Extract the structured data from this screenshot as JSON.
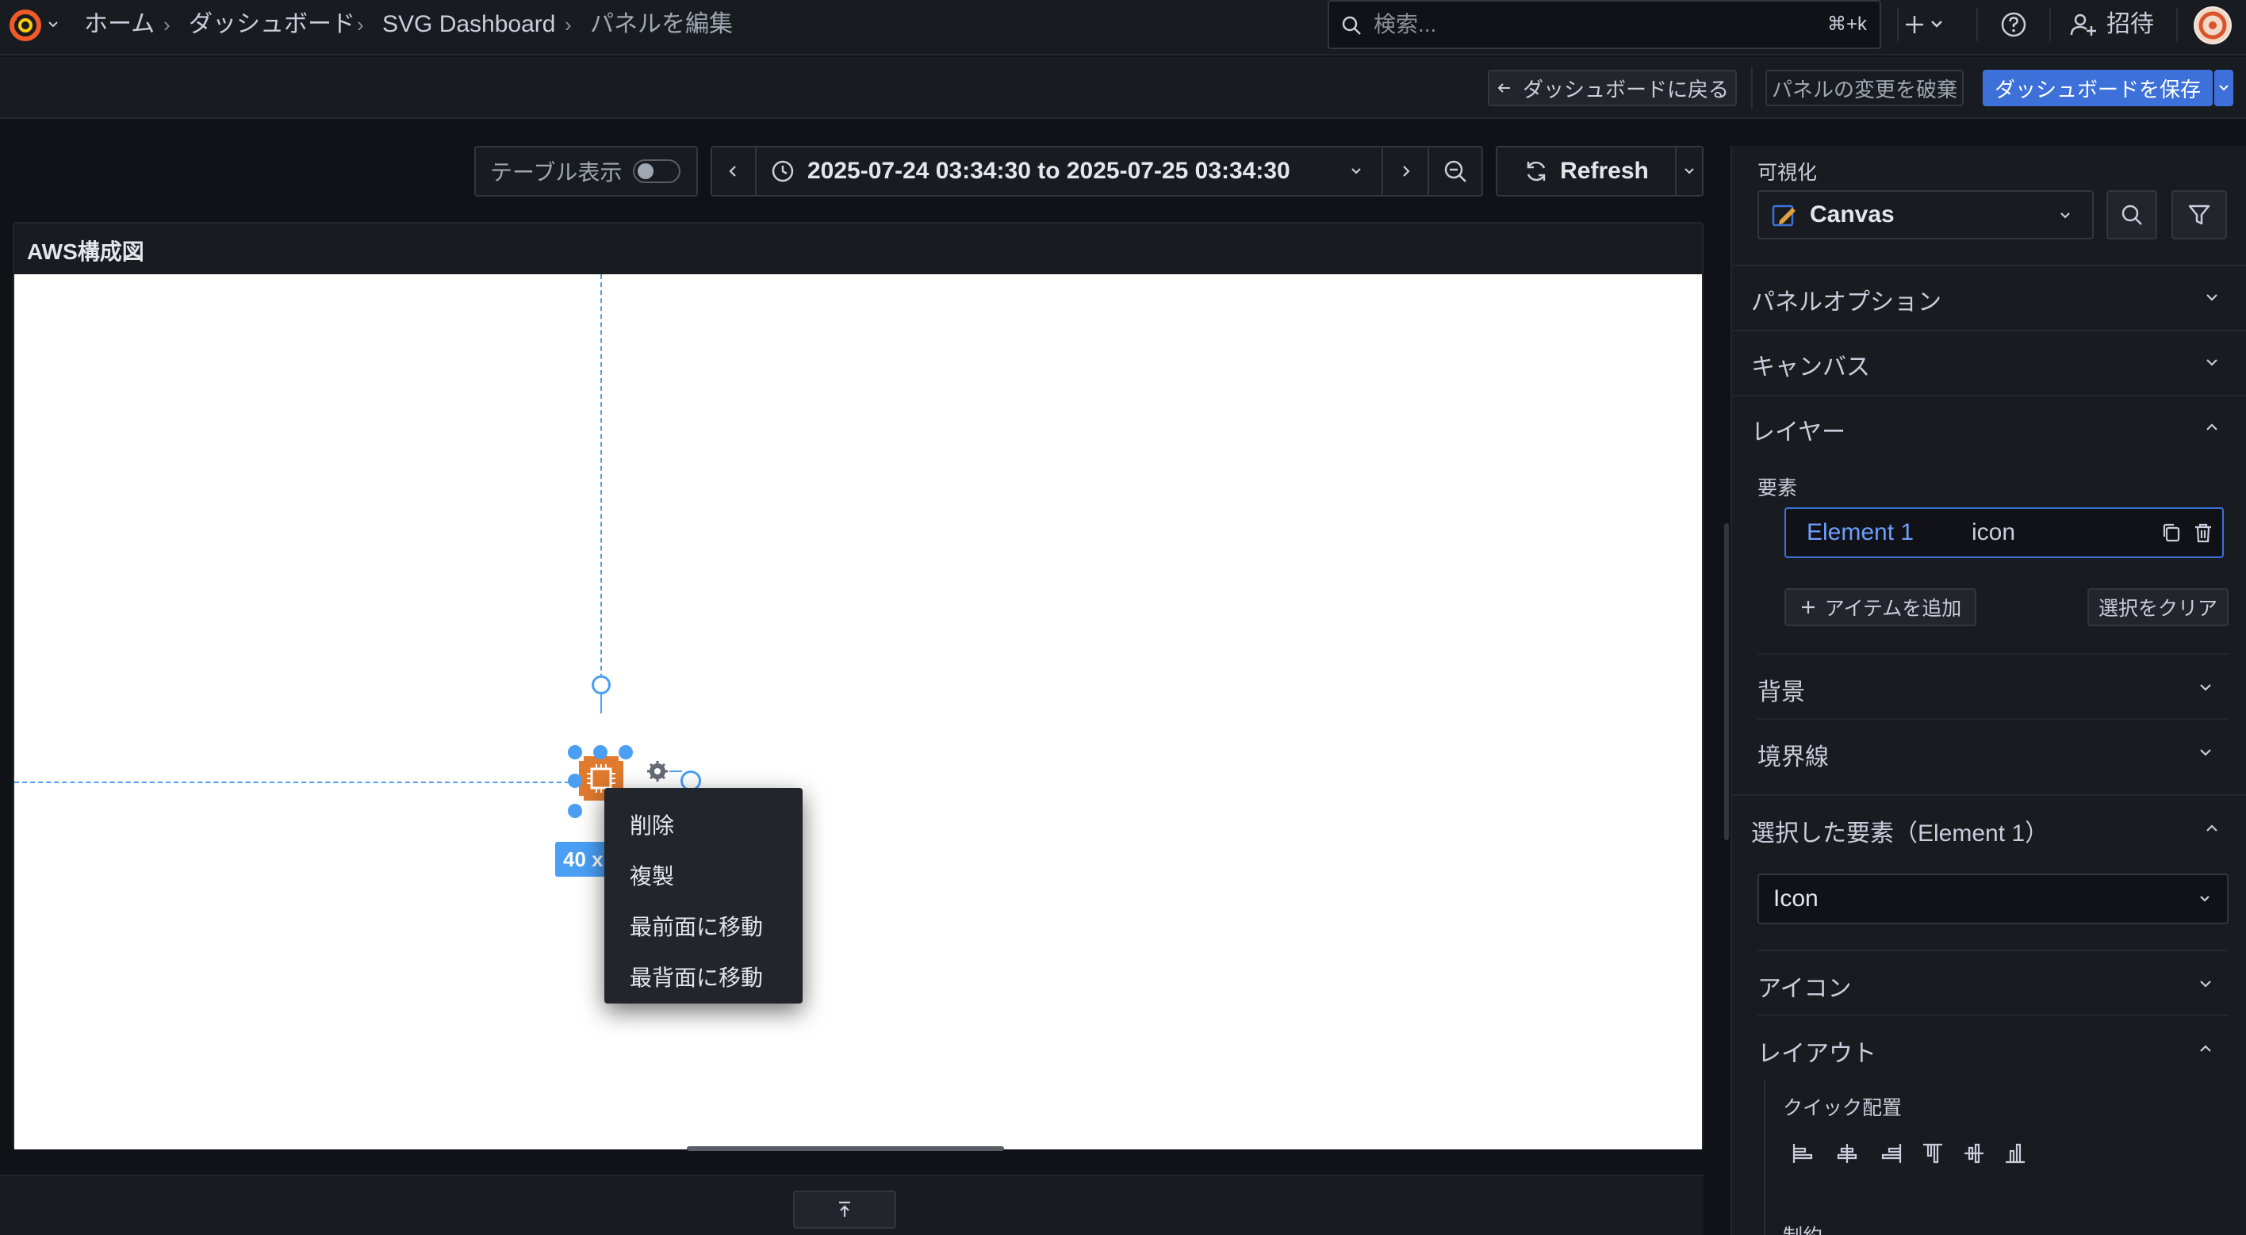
{
  "breadcrumb": {
    "items": [
      "ホーム",
      "ダッシュボード",
      "SVG Dashboard"
    ],
    "current": "パネルを編集"
  },
  "search": {
    "placeholder": "検索...",
    "shortcut": "⌘+k"
  },
  "topbar": {
    "invite_label": "招待"
  },
  "editbar": {
    "back_label": "ダッシュボードに戻る",
    "discard_label": "パネルの変更を破棄",
    "save_label": "ダッシュボードを保存"
  },
  "controls": {
    "table_view_label": "テーブル表示",
    "table_view_on": false,
    "time_range": "2025-07-24 03:34:30 to 2025-07-25 03:34:30",
    "refresh_label": "Refresh"
  },
  "panel": {
    "title": "AWS構成図"
  },
  "element": {
    "size_label": "40 x"
  },
  "context_menu": {
    "items": [
      "削除",
      "複製",
      "最前面に移動",
      "最背面に移動"
    ]
  },
  "right_pane": {
    "visualization_label": "可視化",
    "visualization_value": "Canvas",
    "sections": {
      "panel_options": "パネルオプション",
      "canvas": "キャンバス",
      "layer": "レイヤー",
      "background": "背景",
      "border": "境界線",
      "selected_element": "選択した要素（Element 1）",
      "icon": "アイコン",
      "layout": "レイアウト"
    },
    "elements_label": "要素",
    "element_row": {
      "name": "Element 1",
      "type": "icon"
    },
    "add_item_label": "アイテムを追加",
    "clear_selection_label": "選択をクリア",
    "element_type_value": "Icon",
    "quick_placement_label": "クイック配置",
    "constraints_label": "制約"
  },
  "colors": {
    "accent_blue": "#3d71d9",
    "link_blue": "#6e9fff",
    "selection_blue": "#4a9ff5",
    "aws_orange": "#e07a2e"
  }
}
